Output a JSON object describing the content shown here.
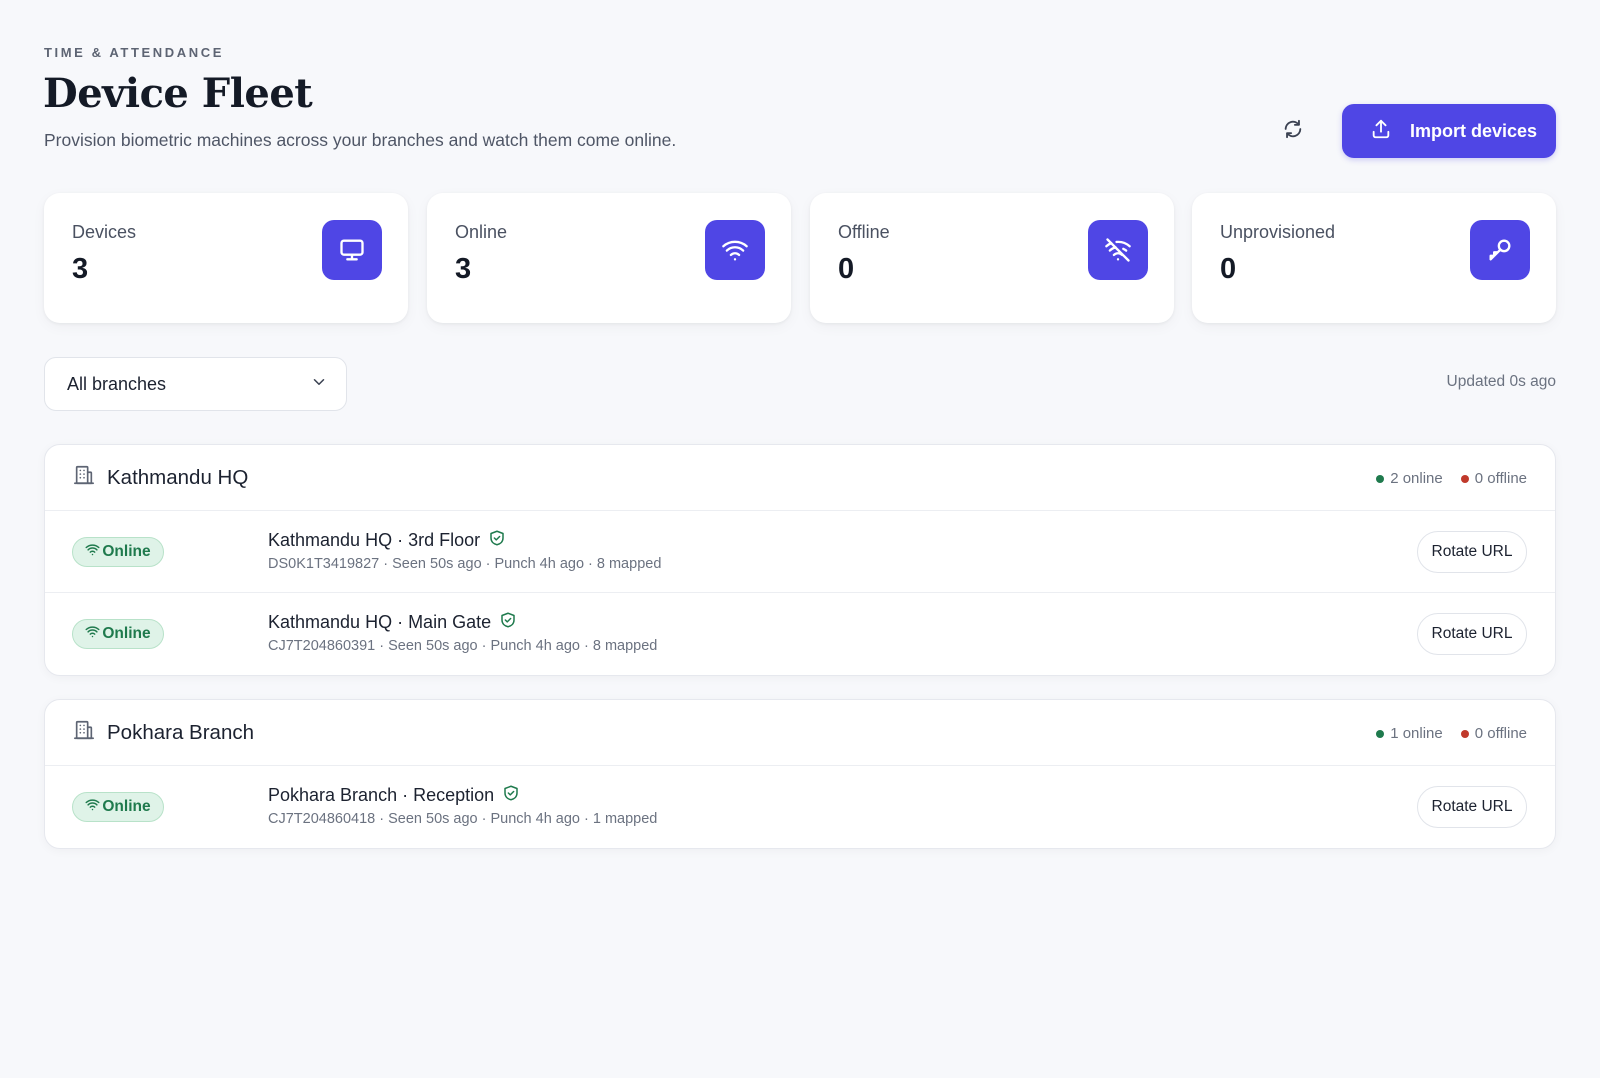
{
  "header": {
    "eyebrow": "TIME & ATTENDANCE",
    "title": "Device Fleet",
    "subtitle": "Provision biometric machines across your branches and watch them come online.",
    "refresh_icon": "refresh-icon",
    "import_label": "Import devices",
    "import_icon": "upload-icon"
  },
  "stats": [
    {
      "label": "Devices",
      "value": "3",
      "icon": "monitor-icon"
    },
    {
      "label": "Online",
      "value": "3",
      "icon": "wifi-icon"
    },
    {
      "label": "Offline",
      "value": "0",
      "icon": "wifi-off-icon"
    },
    {
      "label": "Unprovisioned",
      "value": "0",
      "icon": "key-icon"
    }
  ],
  "filter": {
    "selected": "All branches",
    "updated": "Updated 0s ago"
  },
  "groups": [
    {
      "name": "Kathmandu HQ",
      "online_count": "2 online",
      "offline_count": "0 offline",
      "devices": [
        {
          "status": "Online",
          "name": "Kathmandu HQ · 3rd Floor",
          "meta": "DS0K1T3419827 · Seen 50s ago · Punch 4h ago · 8 mapped",
          "action": "Rotate URL"
        },
        {
          "status": "Online",
          "name": "Kathmandu HQ · Main Gate",
          "meta": "CJ7T204860391 · Seen 50s ago · Punch 4h ago · 8 mapped",
          "action": "Rotate URL"
        }
      ]
    },
    {
      "name": "Pokhara Branch",
      "online_count": "1 online",
      "offline_count": "0 offline",
      "devices": [
        {
          "status": "Online",
          "name": "Pokhara Branch · Reception",
          "meta": "CJ7T204860418 · Seen 50s ago · Punch 4h ago · 1 mapped",
          "action": "Rotate URL"
        }
      ]
    }
  ],
  "colors": {
    "accent": "#4f46e5",
    "online": "#1f7a4d",
    "offline": "#c0392b",
    "background": "#f7f8fb"
  }
}
